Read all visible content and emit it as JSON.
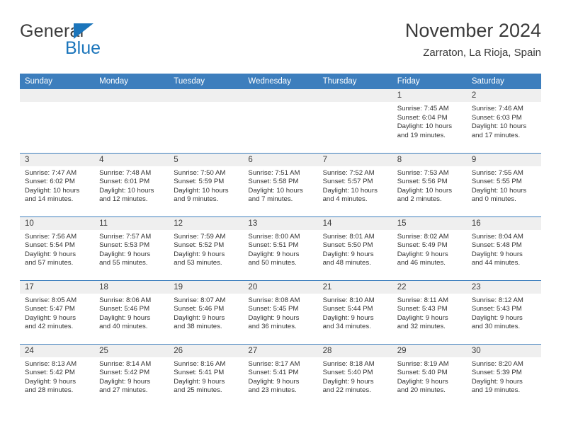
{
  "brand": {
    "name_top": "General",
    "name_bottom": "Blue",
    "triangle_color": "#1b75bb",
    "text_color": "#3c3c3c"
  },
  "header": {
    "title": "November 2024",
    "subtitle": "Zarraton, La Rioja, Spain"
  },
  "theme": {
    "header_blue": "#3d7ebd",
    "daynum_band": "#efefef",
    "text": "#333333"
  },
  "weekday_headers": [
    "Sunday",
    "Monday",
    "Tuesday",
    "Wednesday",
    "Thursday",
    "Friday",
    "Saturday"
  ],
  "weeks": [
    [
      {
        "day": "",
        "empty": true,
        "sunrise": "",
        "sunset": "",
        "daylight_line1": "",
        "daylight_line2": ""
      },
      {
        "day": "",
        "empty": true,
        "sunrise": "",
        "sunset": "",
        "daylight_line1": "",
        "daylight_line2": ""
      },
      {
        "day": "",
        "empty": true,
        "sunrise": "",
        "sunset": "",
        "daylight_line1": "",
        "daylight_line2": ""
      },
      {
        "day": "",
        "empty": true,
        "sunrise": "",
        "sunset": "",
        "daylight_line1": "",
        "daylight_line2": ""
      },
      {
        "day": "",
        "empty": true,
        "sunrise": "",
        "sunset": "",
        "daylight_line1": "",
        "daylight_line2": ""
      },
      {
        "day": "1",
        "empty": false,
        "sunrise": "Sunrise: 7:45 AM",
        "sunset": "Sunset: 6:04 PM",
        "daylight_line1": "Daylight: 10 hours",
        "daylight_line2": "and 19 minutes."
      },
      {
        "day": "2",
        "empty": false,
        "sunrise": "Sunrise: 7:46 AM",
        "sunset": "Sunset: 6:03 PM",
        "daylight_line1": "Daylight: 10 hours",
        "daylight_line2": "and 17 minutes."
      }
    ],
    [
      {
        "day": "3",
        "empty": false,
        "sunrise": "Sunrise: 7:47 AM",
        "sunset": "Sunset: 6:02 PM",
        "daylight_line1": "Daylight: 10 hours",
        "daylight_line2": "and 14 minutes."
      },
      {
        "day": "4",
        "empty": false,
        "sunrise": "Sunrise: 7:48 AM",
        "sunset": "Sunset: 6:01 PM",
        "daylight_line1": "Daylight: 10 hours",
        "daylight_line2": "and 12 minutes."
      },
      {
        "day": "5",
        "empty": false,
        "sunrise": "Sunrise: 7:50 AM",
        "sunset": "Sunset: 5:59 PM",
        "daylight_line1": "Daylight: 10 hours",
        "daylight_line2": "and 9 minutes."
      },
      {
        "day": "6",
        "empty": false,
        "sunrise": "Sunrise: 7:51 AM",
        "sunset": "Sunset: 5:58 PM",
        "daylight_line1": "Daylight: 10 hours",
        "daylight_line2": "and 7 minutes."
      },
      {
        "day": "7",
        "empty": false,
        "sunrise": "Sunrise: 7:52 AM",
        "sunset": "Sunset: 5:57 PM",
        "daylight_line1": "Daylight: 10 hours",
        "daylight_line2": "and 4 minutes."
      },
      {
        "day": "8",
        "empty": false,
        "sunrise": "Sunrise: 7:53 AM",
        "sunset": "Sunset: 5:56 PM",
        "daylight_line1": "Daylight: 10 hours",
        "daylight_line2": "and 2 minutes."
      },
      {
        "day": "9",
        "empty": false,
        "sunrise": "Sunrise: 7:55 AM",
        "sunset": "Sunset: 5:55 PM",
        "daylight_line1": "Daylight: 10 hours",
        "daylight_line2": "and 0 minutes."
      }
    ],
    [
      {
        "day": "10",
        "empty": false,
        "sunrise": "Sunrise: 7:56 AM",
        "sunset": "Sunset: 5:54 PM",
        "daylight_line1": "Daylight: 9 hours",
        "daylight_line2": "and 57 minutes."
      },
      {
        "day": "11",
        "empty": false,
        "sunrise": "Sunrise: 7:57 AM",
        "sunset": "Sunset: 5:53 PM",
        "daylight_line1": "Daylight: 9 hours",
        "daylight_line2": "and 55 minutes."
      },
      {
        "day": "12",
        "empty": false,
        "sunrise": "Sunrise: 7:59 AM",
        "sunset": "Sunset: 5:52 PM",
        "daylight_line1": "Daylight: 9 hours",
        "daylight_line2": "and 53 minutes."
      },
      {
        "day": "13",
        "empty": false,
        "sunrise": "Sunrise: 8:00 AM",
        "sunset": "Sunset: 5:51 PM",
        "daylight_line1": "Daylight: 9 hours",
        "daylight_line2": "and 50 minutes."
      },
      {
        "day": "14",
        "empty": false,
        "sunrise": "Sunrise: 8:01 AM",
        "sunset": "Sunset: 5:50 PM",
        "daylight_line1": "Daylight: 9 hours",
        "daylight_line2": "and 48 minutes."
      },
      {
        "day": "15",
        "empty": false,
        "sunrise": "Sunrise: 8:02 AM",
        "sunset": "Sunset: 5:49 PM",
        "daylight_line1": "Daylight: 9 hours",
        "daylight_line2": "and 46 minutes."
      },
      {
        "day": "16",
        "empty": false,
        "sunrise": "Sunrise: 8:04 AM",
        "sunset": "Sunset: 5:48 PM",
        "daylight_line1": "Daylight: 9 hours",
        "daylight_line2": "and 44 minutes."
      }
    ],
    [
      {
        "day": "17",
        "empty": false,
        "sunrise": "Sunrise: 8:05 AM",
        "sunset": "Sunset: 5:47 PM",
        "daylight_line1": "Daylight: 9 hours",
        "daylight_line2": "and 42 minutes."
      },
      {
        "day": "18",
        "empty": false,
        "sunrise": "Sunrise: 8:06 AM",
        "sunset": "Sunset: 5:46 PM",
        "daylight_line1": "Daylight: 9 hours",
        "daylight_line2": "and 40 minutes."
      },
      {
        "day": "19",
        "empty": false,
        "sunrise": "Sunrise: 8:07 AM",
        "sunset": "Sunset: 5:46 PM",
        "daylight_line1": "Daylight: 9 hours",
        "daylight_line2": "and 38 minutes."
      },
      {
        "day": "20",
        "empty": false,
        "sunrise": "Sunrise: 8:08 AM",
        "sunset": "Sunset: 5:45 PM",
        "daylight_line1": "Daylight: 9 hours",
        "daylight_line2": "and 36 minutes."
      },
      {
        "day": "21",
        "empty": false,
        "sunrise": "Sunrise: 8:10 AM",
        "sunset": "Sunset: 5:44 PM",
        "daylight_line1": "Daylight: 9 hours",
        "daylight_line2": "and 34 minutes."
      },
      {
        "day": "22",
        "empty": false,
        "sunrise": "Sunrise: 8:11 AM",
        "sunset": "Sunset: 5:43 PM",
        "daylight_line1": "Daylight: 9 hours",
        "daylight_line2": "and 32 minutes."
      },
      {
        "day": "23",
        "empty": false,
        "sunrise": "Sunrise: 8:12 AM",
        "sunset": "Sunset: 5:43 PM",
        "daylight_line1": "Daylight: 9 hours",
        "daylight_line2": "and 30 minutes."
      }
    ],
    [
      {
        "day": "24",
        "empty": false,
        "sunrise": "Sunrise: 8:13 AM",
        "sunset": "Sunset: 5:42 PM",
        "daylight_line1": "Daylight: 9 hours",
        "daylight_line2": "and 28 minutes."
      },
      {
        "day": "25",
        "empty": false,
        "sunrise": "Sunrise: 8:14 AM",
        "sunset": "Sunset: 5:42 PM",
        "daylight_line1": "Daylight: 9 hours",
        "daylight_line2": "and 27 minutes."
      },
      {
        "day": "26",
        "empty": false,
        "sunrise": "Sunrise: 8:16 AM",
        "sunset": "Sunset: 5:41 PM",
        "daylight_line1": "Daylight: 9 hours",
        "daylight_line2": "and 25 minutes."
      },
      {
        "day": "27",
        "empty": false,
        "sunrise": "Sunrise: 8:17 AM",
        "sunset": "Sunset: 5:41 PM",
        "daylight_line1": "Daylight: 9 hours",
        "daylight_line2": "and 23 minutes."
      },
      {
        "day": "28",
        "empty": false,
        "sunrise": "Sunrise: 8:18 AM",
        "sunset": "Sunset: 5:40 PM",
        "daylight_line1": "Daylight: 9 hours",
        "daylight_line2": "and 22 minutes."
      },
      {
        "day": "29",
        "empty": false,
        "sunrise": "Sunrise: 8:19 AM",
        "sunset": "Sunset: 5:40 PM",
        "daylight_line1": "Daylight: 9 hours",
        "daylight_line2": "and 20 minutes."
      },
      {
        "day": "30",
        "empty": false,
        "sunrise": "Sunrise: 8:20 AM",
        "sunset": "Sunset: 5:39 PM",
        "daylight_line1": "Daylight: 9 hours",
        "daylight_line2": "and 19 minutes."
      }
    ]
  ]
}
